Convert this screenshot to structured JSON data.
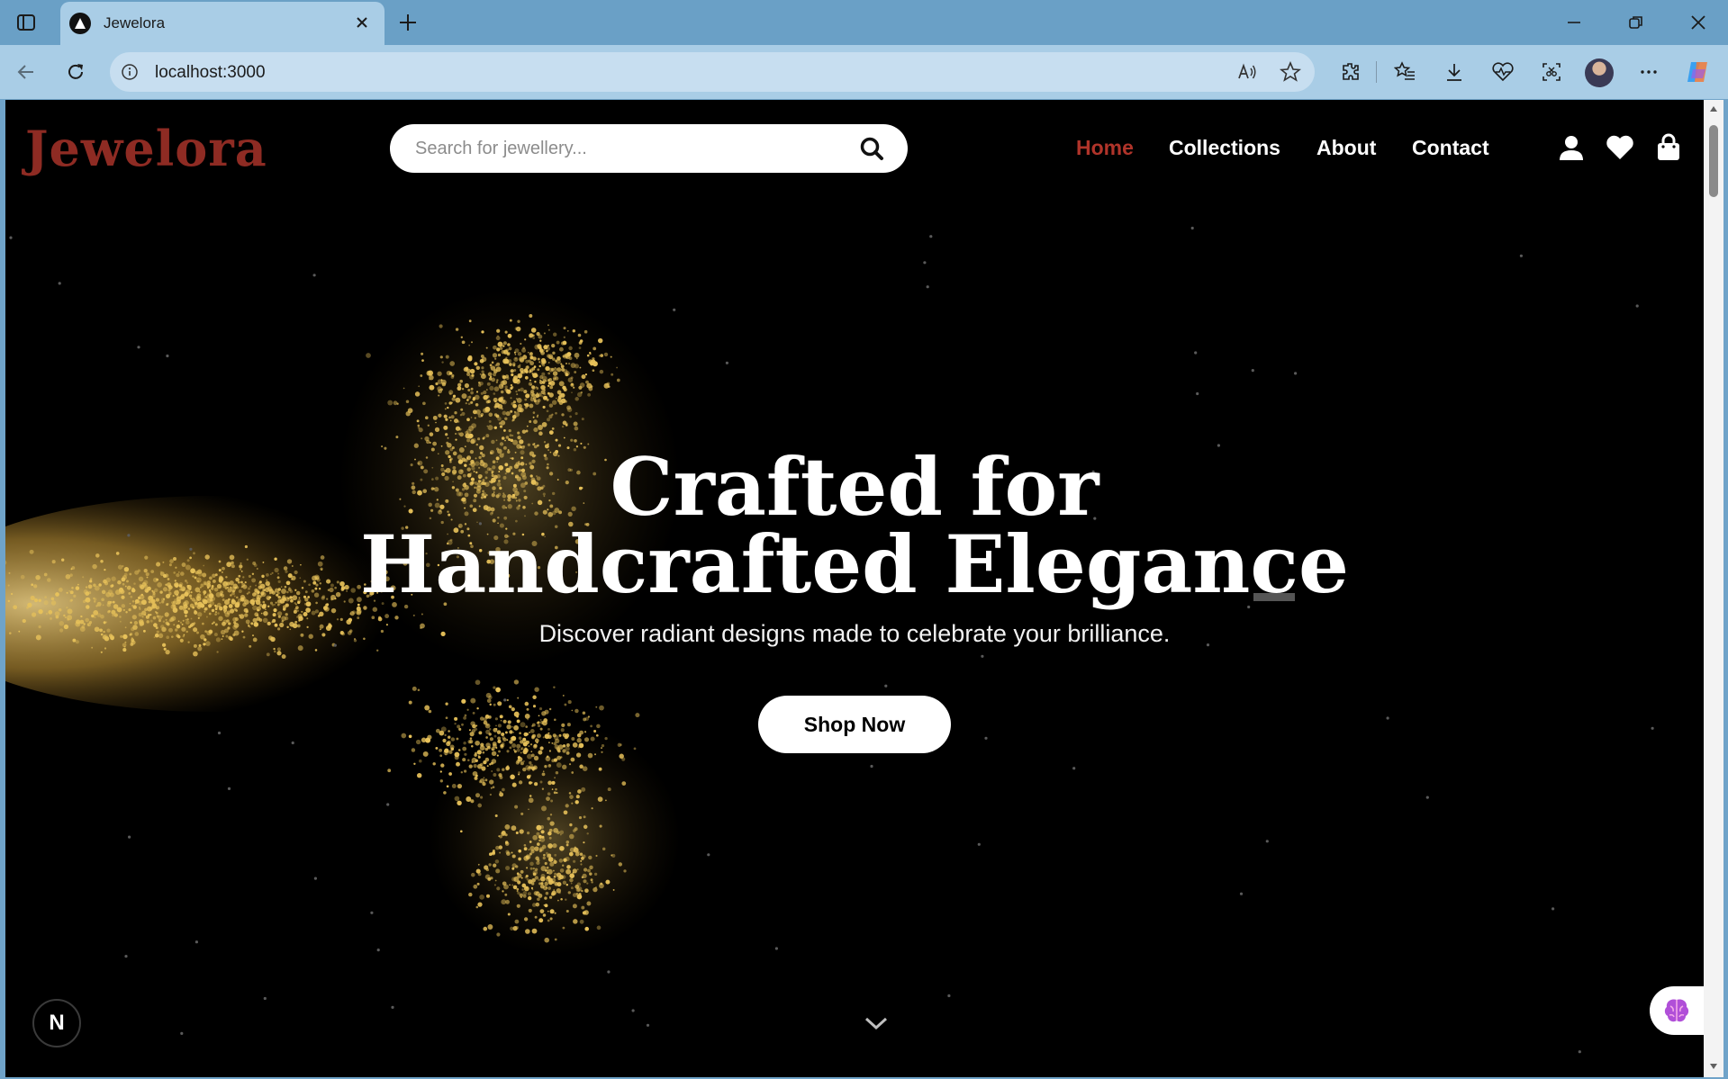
{
  "browser": {
    "tab": {
      "title": "Jewelora"
    },
    "address_bar": {
      "url": "localhost:3000"
    }
  },
  "site": {
    "logo": "Jewelora",
    "search": {
      "placeholder": "Search for jewellery...",
      "value": ""
    },
    "nav": [
      {
        "label": "Home",
        "active": true
      },
      {
        "label": "Collections",
        "active": false
      },
      {
        "label": "About",
        "active": false
      },
      {
        "label": "Contact",
        "active": false
      }
    ],
    "header_icons": [
      "user-icon",
      "heart-icon",
      "shopping-bag-icon"
    ]
  },
  "hero": {
    "title_line1": "Crafted for",
    "title_line2": "Handcrafted Elegance",
    "subtitle": "Discover radiant designs made to celebrate your brilliance.",
    "cta_label": "Shop Now"
  },
  "dev_badge": {
    "label": "N"
  },
  "colors": {
    "brand": "#8e2b23",
    "nav_active": "#b0342a",
    "hero_bg": "#000000",
    "particle_gold": "#e8c25a",
    "tab_strip": "#6aa0c6",
    "toolbar": "#a9cde6"
  }
}
